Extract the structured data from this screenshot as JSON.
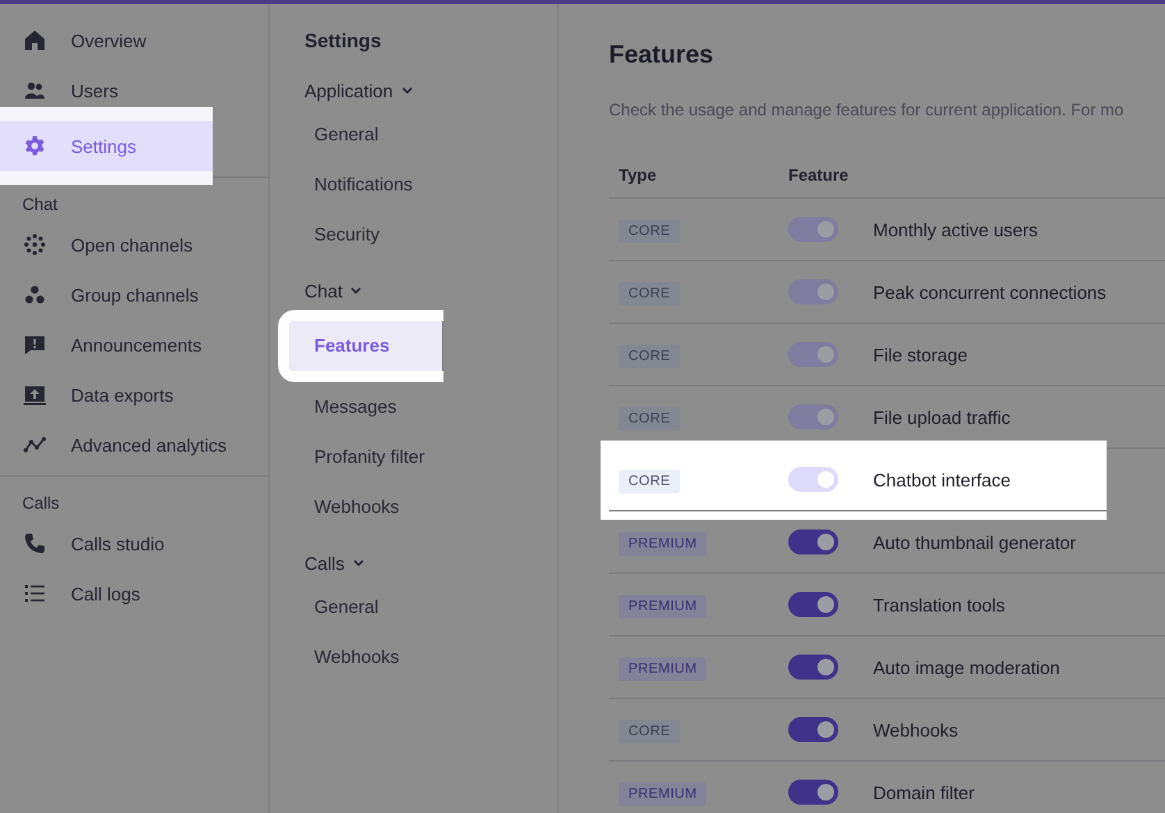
{
  "sidebar": {
    "sections": [
      {
        "items": [
          {
            "label": "Overview",
            "selected": false,
            "highlighted": false
          },
          {
            "label": "Users",
            "selected": false,
            "highlighted": false
          },
          {
            "label": "Settings",
            "selected": true,
            "highlighted": true
          }
        ]
      },
      {
        "heading": "Chat",
        "items": [
          {
            "label": "Open channels",
            "selected": false,
            "highlighted": false
          },
          {
            "label": "Group channels",
            "selected": false,
            "highlighted": false
          },
          {
            "label": "Announcements",
            "selected": false,
            "highlighted": false
          },
          {
            "label": "Data exports",
            "selected": false,
            "highlighted": false
          },
          {
            "label": "Advanced analytics",
            "selected": false,
            "highlighted": false
          }
        ]
      },
      {
        "heading": "Calls",
        "items": [
          {
            "label": "Calls studio",
            "selected": false,
            "highlighted": false
          },
          {
            "label": "Call logs",
            "selected": false,
            "highlighted": false
          }
        ]
      }
    ]
  },
  "settings_nav": {
    "title": "Settings",
    "groups": [
      {
        "label": "Application",
        "expanded": true,
        "items": [
          {
            "label": "General",
            "selected": false,
            "highlighted": false
          },
          {
            "label": "Notifications",
            "selected": false,
            "highlighted": false
          },
          {
            "label": "Security",
            "selected": false,
            "highlighted": false
          }
        ]
      },
      {
        "label": "Chat",
        "expanded": true,
        "items": [
          {
            "label": "Features",
            "selected": true,
            "highlighted": true
          },
          {
            "label": "Messages",
            "selected": false,
            "highlighted": false
          },
          {
            "label": "Profanity filter",
            "selected": false,
            "highlighted": false
          },
          {
            "label": "Webhooks",
            "selected": false,
            "highlighted": false
          }
        ]
      },
      {
        "label": "Calls",
        "expanded": true,
        "items": [
          {
            "label": "General",
            "selected": false,
            "highlighted": false
          },
          {
            "label": "Webhooks",
            "selected": false,
            "highlighted": false
          }
        ]
      }
    ]
  },
  "main": {
    "title": "Features",
    "description": "Check the usage and manage features for current application. For mo",
    "table": {
      "columns": [
        "Type",
        "Feature"
      ],
      "rows": [
        {
          "type": "CORE",
          "kind": "core",
          "feature": "Monthly active users",
          "on": true,
          "disabled": true,
          "highlighted": false
        },
        {
          "type": "CORE",
          "kind": "core",
          "feature": "Peak concurrent connections",
          "on": true,
          "disabled": true,
          "highlighted": false
        },
        {
          "type": "CORE",
          "kind": "core",
          "feature": "File storage",
          "on": true,
          "disabled": true,
          "highlighted": false
        },
        {
          "type": "CORE",
          "kind": "core",
          "feature": "File upload traffic",
          "on": true,
          "disabled": true,
          "highlighted": false
        },
        {
          "type": "CORE",
          "kind": "core",
          "feature": "Chatbot interface",
          "on": true,
          "disabled": true,
          "highlighted": true
        },
        {
          "type": "PREMIUM",
          "kind": "premium",
          "feature": "Auto thumbnail generator",
          "on": true,
          "disabled": false,
          "highlighted": false
        },
        {
          "type": "PREMIUM",
          "kind": "premium",
          "feature": "Translation tools",
          "on": true,
          "disabled": false,
          "highlighted": false
        },
        {
          "type": "PREMIUM",
          "kind": "premium",
          "feature": "Auto image moderation",
          "on": true,
          "disabled": false,
          "highlighted": false
        },
        {
          "type": "CORE",
          "kind": "core",
          "feature": "Webhooks",
          "on": true,
          "disabled": false,
          "highlighted": false
        },
        {
          "type": "PREMIUM",
          "kind": "premium",
          "feature": "Domain filter",
          "on": true,
          "disabled": false,
          "highlighted": false
        }
      ]
    }
  }
}
